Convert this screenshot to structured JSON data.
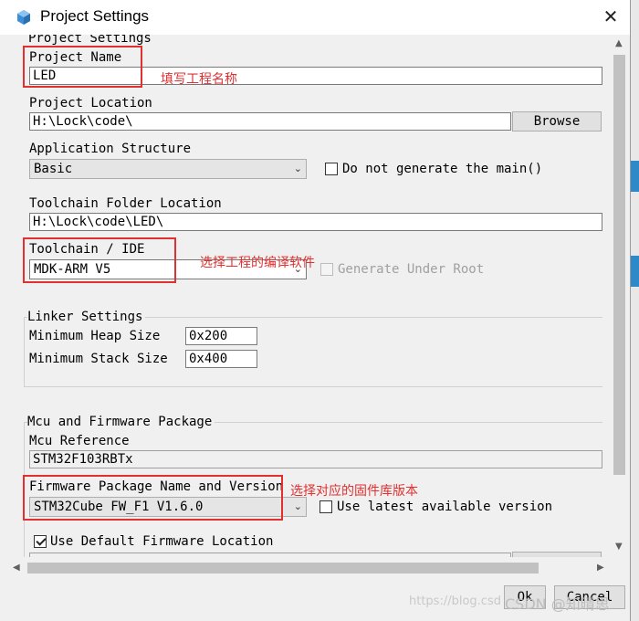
{
  "window": {
    "title": "Project Settings",
    "close_glyph": "✕"
  },
  "section_header": "Project Settings",
  "project_name": {
    "label": "Project Name",
    "value": "LED"
  },
  "project_location": {
    "label": "Project Location",
    "value": "H:\\Lock\\code\\",
    "browse": "Browse"
  },
  "application_structure": {
    "label": "Application Structure",
    "value": "Basic",
    "checkbox": "Do not generate the main()"
  },
  "toolchain_folder": {
    "label": "Toolchain Folder Location",
    "value": "H:\\Lock\\code\\LED\\"
  },
  "toolchain_ide": {
    "label": "Toolchain / IDE",
    "value": "MDK-ARM V5",
    "checkbox": "Generate Under Root"
  },
  "linker": {
    "label": "Linker Settings",
    "heap_label": "Minimum Heap Size",
    "heap_value": "0x200",
    "stack_label": "Minimum Stack Size",
    "stack_value": "0x400"
  },
  "mcu": {
    "label": "Mcu and Firmware Package",
    "ref_label": "Mcu Reference",
    "ref_value": "STM32F103RBTx",
    "fw_label": "Firmware Package Name and Version",
    "fw_value": "STM32Cube FW_F1 V1.6.0",
    "latest_checkbox": "Use latest available version",
    "default_location_checkbox": "Use Default Firmware Location",
    "default_location_checked": true
  },
  "annotations": {
    "name": "填写工程名称",
    "ide": "选择工程的编译软件",
    "firmware": "选择对应的固件库版本"
  },
  "footer": {
    "ok": "Ok",
    "cancel": "Cancel"
  },
  "watermark": {
    "url": "https://blog.csd",
    "brand": "CSDN @知晴思"
  },
  "colors": {
    "annotation_red": "#e03030",
    "accent_blue": "#2d89c8"
  },
  "icons": {
    "app": "cube-icon",
    "close": "close-icon",
    "dropdown": "chevron-down-icon"
  }
}
